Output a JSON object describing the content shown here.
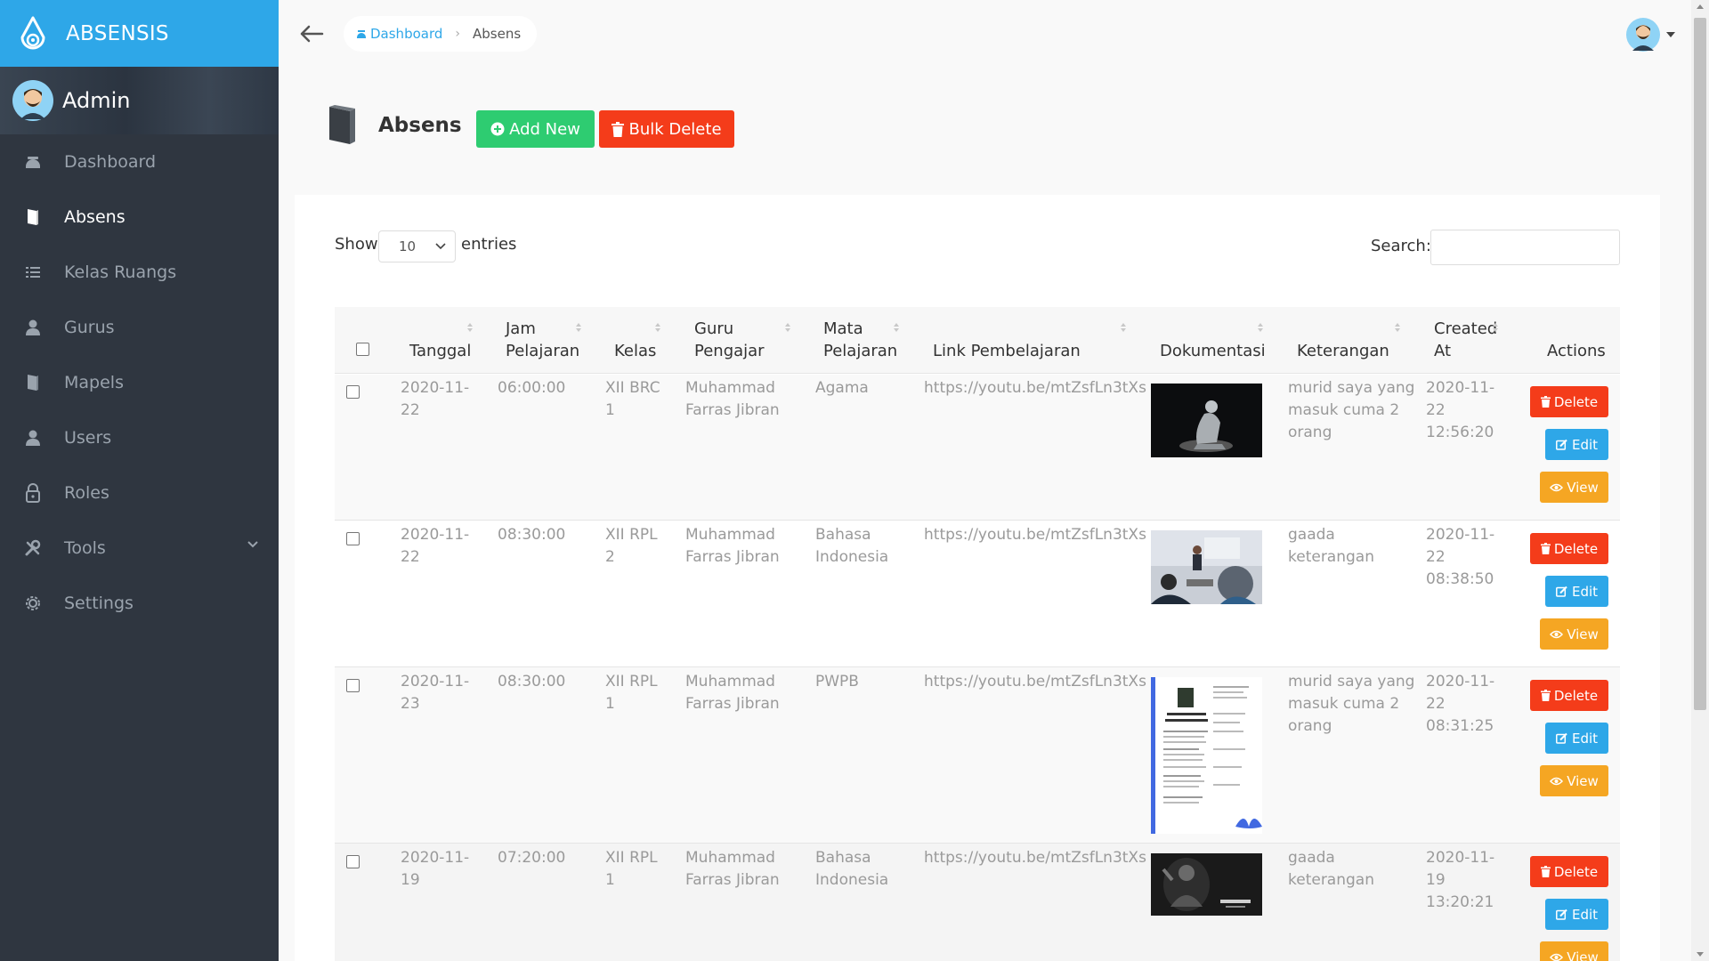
{
  "app": {
    "name": "ABSENSIS"
  },
  "user": {
    "name": "Admin"
  },
  "sidebar": {
    "items": [
      {
        "label": "Dashboard",
        "icon": "dashboard-icon",
        "active": false
      },
      {
        "label": "Absens",
        "icon": "book-icon",
        "active": true
      },
      {
        "label": "Kelas Ruangs",
        "icon": "list-icon",
        "active": false
      },
      {
        "label": "Gurus",
        "icon": "user-icon",
        "active": false
      },
      {
        "label": "Mapels",
        "icon": "book-icon",
        "active": false
      },
      {
        "label": "Users",
        "icon": "user-icon",
        "active": false
      },
      {
        "label": "Roles",
        "icon": "lock-icon",
        "active": false
      },
      {
        "label": "Tools",
        "icon": "tools-icon",
        "active": false,
        "has_submenu": true
      },
      {
        "label": "Settings",
        "icon": "gear-icon",
        "active": false
      }
    ]
  },
  "breadcrumb": {
    "home": "Dashboard",
    "current": "Absens"
  },
  "page": {
    "title": "Absens",
    "add_label": "Add New",
    "bulk_delete_label": "Bulk Delete"
  },
  "table_controls": {
    "show_label": "Show",
    "page_length": "10",
    "entries_label": "entries",
    "search_label": "Search:",
    "search_value": ""
  },
  "table": {
    "headers": {
      "tanggal": "Tanggal",
      "jam_1": "Jam",
      "jam_2": "Pelajaran",
      "kelas": "Kelas",
      "guru_1": "Guru",
      "guru_2": "Pengajar",
      "mapel_1": "Mata",
      "mapel_2": "Pelajaran",
      "link": "Link Pembelajaran",
      "dokumentasi": "Dokumentasi",
      "keterangan": "Keterangan",
      "created_1": "Created",
      "created_2": "At",
      "actions": "Actions"
    },
    "rows": [
      {
        "tanggal": [
          "2020-11-",
          "22"
        ],
        "jam": "06:00:00",
        "kelas": [
          "XII BRC",
          "1"
        ],
        "guru": [
          "Muhammad",
          "Farras Jibran"
        ],
        "mapel": [
          "Agama"
        ],
        "link": "https://youtu.be/mtZsfLn3tXs",
        "keterangan": [
          "murid saya yang",
          "masuk cuma 2",
          "orang"
        ],
        "created": [
          "2020-11-",
          "22",
          "12:56:20"
        ]
      },
      {
        "tanggal": [
          "2020-11-",
          "22"
        ],
        "jam": "08:30:00",
        "kelas": [
          "XII RPL",
          "2"
        ],
        "guru": [
          "Muhammad",
          "Farras Jibran"
        ],
        "mapel": [
          "Bahasa",
          "Indonesia"
        ],
        "link": "https://youtu.be/mtZsfLn3tXs",
        "keterangan": [
          "gaada",
          "keterangan"
        ],
        "created": [
          "2020-11-",
          "22",
          "08:38:50"
        ]
      },
      {
        "tanggal": [
          "2020-11-",
          "23"
        ],
        "jam": "08:30:00",
        "kelas": [
          "XII RPL",
          "1"
        ],
        "guru": [
          "Muhammad",
          "Farras Jibran"
        ],
        "mapel": [
          "PWPB"
        ],
        "link": "https://youtu.be/mtZsfLn3tXs",
        "keterangan": [
          "murid saya yang",
          "masuk cuma 2",
          "orang"
        ],
        "created": [
          "2020-11-",
          "22",
          "08:31:25"
        ]
      },
      {
        "tanggal": [
          "2020-11-",
          "19"
        ],
        "jam": "07:20:00",
        "kelas": [
          "XII RPL",
          "1"
        ],
        "guru": [
          "Muhammad",
          "Farras Jibran"
        ],
        "mapel": [
          "Bahasa",
          "Indonesia"
        ],
        "link": "https://youtu.be/mtZsfLn3tXs",
        "keterangan": [
          "gaada",
          "keterangan"
        ],
        "created": [
          "2020-11-",
          "19",
          "13:20:21"
        ]
      }
    ],
    "action_labels": {
      "delete": "Delete",
      "edit": "Edit",
      "view": "View"
    }
  },
  "colors": {
    "brand": "#2ea7e8",
    "sidebar": "#2f3640",
    "success": "#2ecc71",
    "danger": "#f43c1a",
    "warning": "#f5a623"
  }
}
